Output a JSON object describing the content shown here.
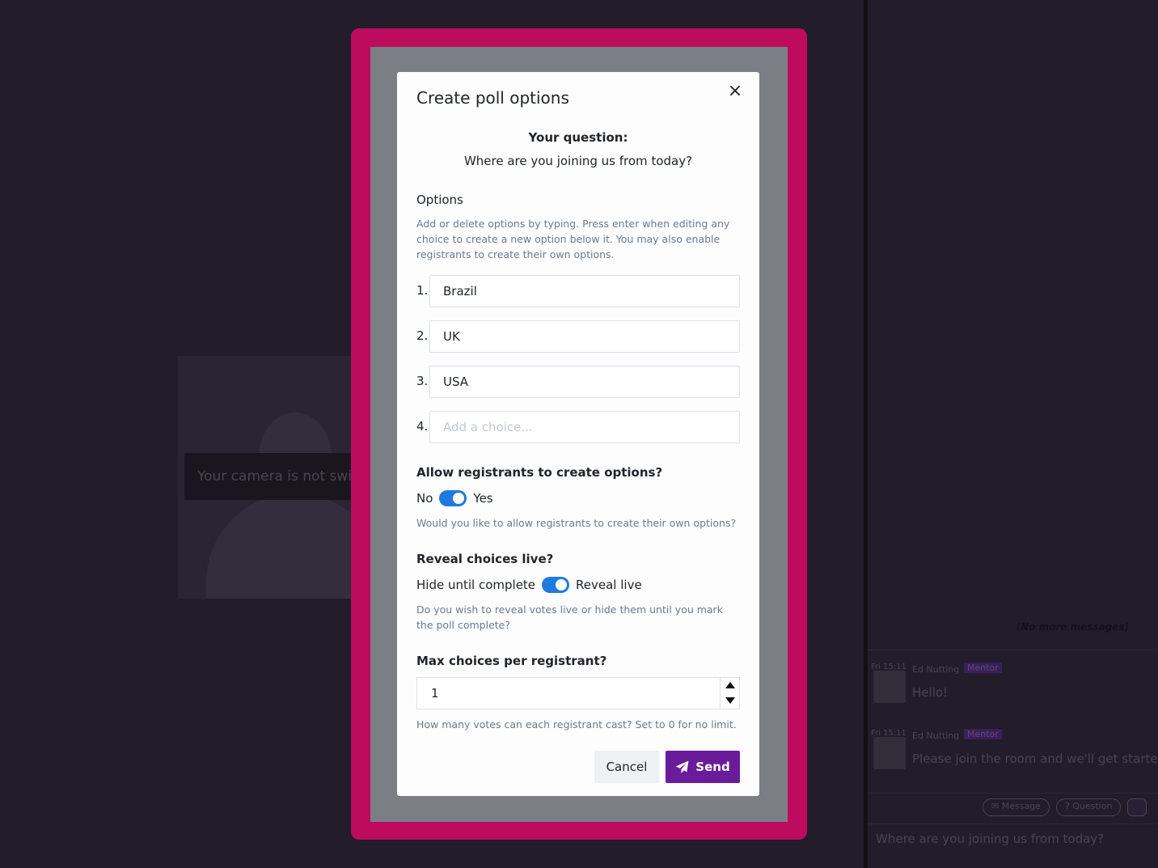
{
  "background": {
    "camera_banner": "Your camera is not switched on",
    "chat": {
      "no_more_messages": "(No more messages)",
      "messages": [
        {
          "time": "Fri 15:11",
          "author": "Ed Nutting",
          "badge": "Mentor",
          "text": "Hello!"
        },
        {
          "time": "Fri 15:11",
          "author": "Ed Nutting",
          "badge": "Mentor",
          "text": "Please join the room and we'll get started s"
        }
      ],
      "actions": {
        "message": "Message",
        "question": "Question"
      },
      "input_value": "Where are you joining us from today?"
    }
  },
  "modal": {
    "title": "Create poll options",
    "close_icon": "×",
    "question_label": "Your question:",
    "question_text": "Where are you joining us from today?",
    "options_heading": "Options",
    "options_help": "Add or delete options by typing. Press enter when editing any choice to create a new option below it. You may also enable registrants to create their own options.",
    "options": [
      {
        "num": "1.",
        "value": "Brazil"
      },
      {
        "num": "2.",
        "value": "UK"
      },
      {
        "num": "3.",
        "value": "USA"
      },
      {
        "num": "4.",
        "value": "",
        "placeholder": "Add a choice..."
      }
    ],
    "allow_create": {
      "heading": "Allow registrants to create options?",
      "off_label": "No",
      "on_label": "Yes",
      "enabled": true,
      "help": "Would you like to allow registrants to create their own options?"
    },
    "reveal": {
      "heading": "Reveal choices live?",
      "off_label": "Hide until complete",
      "on_label": "Reveal live",
      "enabled": true,
      "help": "Do you wish to reveal votes live or hide them until you mark the poll complete?"
    },
    "max_choices": {
      "heading": "Max choices per registrant?",
      "value": "1",
      "help": "How many votes can each registrant cast? Set to 0 for no limit."
    },
    "cancel_label": "Cancel",
    "send_label": "Send"
  },
  "colors": {
    "highlight": "#bd0c5e",
    "toggle_on": "#1f7ae0",
    "send_button": "#6a1b9a"
  }
}
